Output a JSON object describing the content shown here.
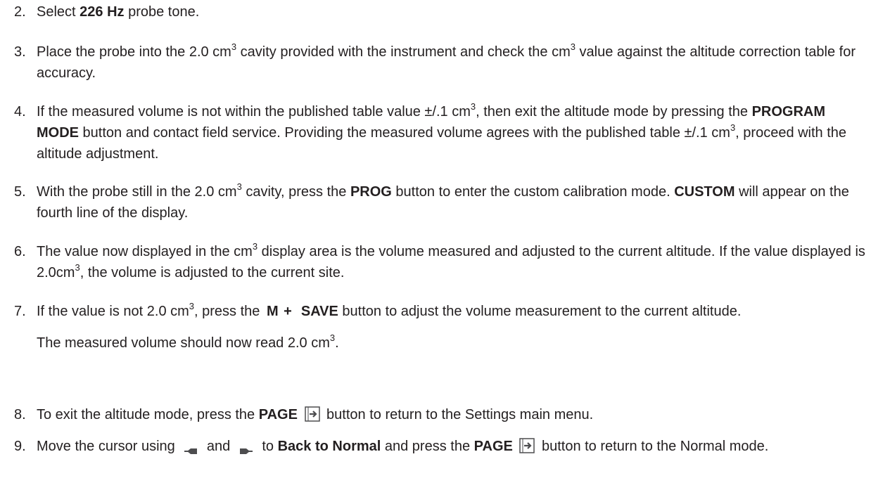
{
  "steps": [
    {
      "number": "2.",
      "t1": "Select ",
      "b1": "226 Hz",
      "t2": " probe tone."
    },
    {
      "number": "3.",
      "t1": "Place the probe into the 2.0 cm",
      "s1": "3",
      "t2": " cavity provided with the instrument and check the cm",
      "s2": "3",
      "t3": " value against the altitude correction table for accuracy."
    },
    {
      "number": "4.",
      "t1": "If the measured volume is not within the published table value ±/.1 cm",
      "s1": "3",
      "t2": ", then exit the  altitude mode by pressing the ",
      "b1": "PROGRAM MODE",
      "t3": " button and contact field service. Providing the measured volume agrees with the published table ±/.1 cm",
      "s2": "3",
      "t4": ", proceed with the altitude adjustment."
    },
    {
      "number": "5.",
      "t1": "With the probe still in the 2.0 cm",
      "s1": "3",
      "t2": " cavity, press the ",
      "b1": "PROG",
      "t3": " button to enter the custom calibration mode. ",
      "b2": "CUSTOM",
      "t4": " will appear on the fourth line of the display."
    },
    {
      "number": "6.",
      "t1": "The value now displayed in the cm",
      "s1": "3",
      "t2": " display area is the volume measured and adjusted to the current altitude. If the value displayed is 2.0cm",
      "s2": "3",
      "t3": ", the volume is adjusted to the current site."
    },
    {
      "number": "7.",
      "t1": "If the value is not 2.0 cm",
      "s1": "3",
      "t2": ", press the ",
      "b1": "M +",
      "b2": "SAVE",
      "t3": " button to adjust the volume measurement to the current altitude.",
      "note": "The measured volume should now read 2.0 cm",
      "note_s": "3",
      "note_end": "."
    },
    {
      "number": "8.",
      "t1": "To exit the altitude mode, press the ",
      "b1": "PAGE",
      "t2": " button to return to the Settings main menu."
    },
    {
      "number": "9.",
      "t1": "Move the cursor using ",
      "t2": " and ",
      "t3": " to ",
      "b1": "Back to Normal",
      "t4": " and press the ",
      "b2": "PAGE",
      "t5": " button to return to the Normal mode."
    }
  ],
  "icons": {
    "page_button": "page-forward-icon",
    "cursor_left": "cursor-left-arrow-icon",
    "cursor_right": "cursor-right-arrow-icon"
  },
  "colors": {
    "text": "#231f20",
    "icon": "#4d4d4f"
  }
}
